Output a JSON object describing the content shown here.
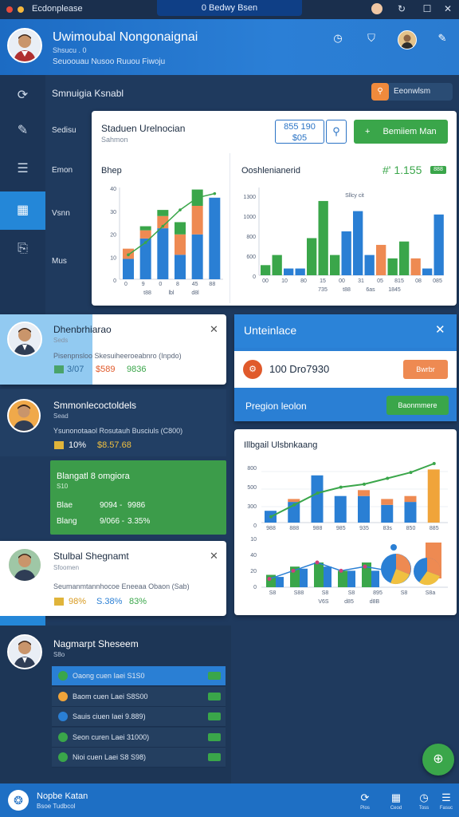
{
  "titlebar": {
    "app_name": "Ecdonplease",
    "tab_title": "0 Bedwy Bsen"
  },
  "header": {
    "title": "Uwimoubal Nongonaignai",
    "subtitle": "Shsucu . 0",
    "meta": "Seuoouau  Nusoo  Ruuou  Fiwoju",
    "icons": [
      "clock-icon",
      "shield-icon",
      "user-avatar",
      "wrench-icon"
    ]
  },
  "sidebar": {
    "items": [
      {
        "icon": "refresh-icon",
        "label": ""
      },
      {
        "icon": "edit-icon",
        "label": "Sedisu"
      },
      {
        "icon": "document-icon",
        "label": "Emon"
      },
      {
        "icon": "chart-icon",
        "label": "Vsnn"
      },
      {
        "icon": "clipboard-icon",
        "label": "Mus"
      }
    ]
  },
  "section": {
    "title": "Smnuigia Ksnabl",
    "pill_label": "Eeonwlsm"
  },
  "dashboard": {
    "title": "Staduen Urelnocian",
    "subtitle": "Sahmon",
    "search_value": "855  190",
    "search_value2": "$05",
    "action_label": "Bemiiem Man",
    "left_chart_label": "Bhep",
    "right_chart_label": "Ooshlenianerid",
    "big_number": "#' 1.155",
    "badge": "888",
    "left_axis_ticks": [
      "40",
      "30",
      "20",
      "10",
      "0"
    ],
    "left_x_ticks": [
      "0",
      "9",
      "0",
      "8",
      "45",
      "88"
    ],
    "left_x_caption": [
      "t88",
      "lbl",
      "d8l"
    ],
    "right_axis_ticks": [
      "1300",
      "1000",
      "800",
      "600",
      "0"
    ],
    "right_x_ticks": [
      "00",
      "10",
      "80",
      "15",
      "00",
      "31",
      "05",
      "815",
      "08",
      "085"
    ],
    "right_x_caption": [
      "735",
      "t88",
      "6as",
      "1845"
    ],
    "right_note": "Sllcy cit"
  },
  "chart_data": [
    {
      "type": "bar",
      "title": "Bhep",
      "categories": [
        "1",
        "2",
        "3",
        "4",
        "5",
        "6"
      ],
      "series": [
        {
          "values": [
            10,
            20,
            25,
            12,
            22,
            40
          ]
        },
        {
          "values": [
            5,
            4,
            6,
            10,
            14,
            0
          ]
        },
        {
          "values": [
            0,
            2,
            3,
            6,
            8,
            0
          ]
        }
      ],
      "line": [
        12,
        18,
        26,
        34,
        40,
        42
      ],
      "ylim": [
        0,
        45
      ]
    },
    {
      "type": "bar",
      "title": "Ooshlenianerid",
      "categories": [
        "1",
        "2",
        "3",
        "4",
        "5",
        "6",
        "7",
        "8",
        "9",
        "10",
        "11",
        "12",
        "13",
        "14",
        "15",
        "16"
      ],
      "values": [
        150,
        300,
        100,
        100,
        550,
        1100,
        300,
        650,
        950,
        300,
        450,
        250,
        500,
        250,
        100,
        900
      ],
      "colors": [
        "#3aa64a",
        "#3aa64a",
        "#2a7fd4",
        "#2a7fd4",
        "#3aa64a",
        "#3aa64a",
        "#3aa64a",
        "#2a7fd4",
        "#2a7fd4",
        "#2a7fd4",
        "#ee8a52",
        "#3aa64a",
        "#3aa64a",
        "#ee8a52",
        "#2a7fd4",
        "#2a7fd4"
      ],
      "ylim": [
        0,
        1300
      ]
    },
    {
      "type": "bar",
      "title": "Illbgail Ulsbnkaang",
      "categories": [
        "1",
        "2",
        "3",
        "4",
        "5",
        "6",
        "7",
        "8"
      ],
      "series": [
        {
          "name": "",
          "values": [
            20,
            35,
            80,
            45,
            45,
            30,
            35,
            90
          ]
        },
        {
          "name": "",
          "values": [
            0,
            5,
            0,
            0,
            10,
            10,
            10,
            0
          ]
        }
      ],
      "line": [
        10,
        30,
        50,
        60,
        65,
        75,
        85,
        100
      ],
      "ylim": [
        0,
        100
      ]
    },
    {
      "type": "bar",
      "categories": [
        "1",
        "2",
        "3",
        "4",
        "5",
        "6",
        "7"
      ],
      "series": [
        {
          "name": "",
          "values": [
            15,
            25,
            30,
            20,
            30,
            20,
            25
          ]
        },
        {
          "name": "",
          "values": [
            5,
            10,
            10,
            10,
            5,
            10,
            60
          ]
        }
      ],
      "ylim": [
        0,
        60
      ]
    }
  ],
  "cards": [
    {
      "name": "Dhenbrhiarao",
      "sub": "Seds",
      "desc": "Pisenpnsloo  Skesuiheeroeabnro (Inpdo)",
      "stat1": "3/07",
      "stat2": "$589",
      "stat3": "9836"
    },
    {
      "name": "Smmonlecoctoldels",
      "sub": "Sead",
      "desc": "Ysunonotaaol  Rosutauh Busciuls (C800)",
      "stat1": "10%",
      "stat2": "$8.57.68"
    },
    {
      "name": "Stulbal Shegnamt",
      "sub": "Sfoomen",
      "desc": "Seumanmtannhocoe Eneeaa Obaon (Sab)",
      "stat1": "98%",
      "stat2": "S.38%",
      "stat3": "83%"
    }
  ],
  "green_panel": {
    "title": "Blangatl 8 omgiora",
    "sub": "S10",
    "rows": [
      {
        "label": "Blae",
        "v1": "9094 -",
        "v2": "9986"
      },
      {
        "label": "Blang",
        "v1": "9/066 -",
        "v2": "3.35%"
      }
    ]
  },
  "info_panel": {
    "title": "Unteinlace",
    "number": "100 Dro7930",
    "button": "Bwrbr",
    "footer_text": "Pregion leolon",
    "footer_button": "Baonmmere"
  },
  "chart_card2": {
    "title": "Illbgail Ulsbnkaang",
    "y_ticks": [
      "800",
      "500",
      "300",
      "0"
    ],
    "x_ticks": [
      "988",
      "888",
      "988",
      "985",
      "935",
      "83s",
      "850",
      "885"
    ],
    "y2_ticks": [
      "10",
      "40",
      "20",
      "0"
    ],
    "x2_ticks": [
      "S8",
      "S88",
      "S8",
      "S8",
      "895",
      "S8",
      "S8a"
    ],
    "x2_caption": [
      "V6S",
      "d85",
      "d8B"
    ]
  },
  "list_section": {
    "name": "Nagmarpt Sheseem",
    "sub": "S8o",
    "items": [
      {
        "icon": "green",
        "text": "Oaong cuen Iaei  S1S0"
      },
      {
        "icon": "orange",
        "text": "Baom cuen Laei  S8S00"
      },
      {
        "icon": "blue",
        "text": "Sauis ciuen Iaei  9.889)"
      },
      {
        "icon": "green",
        "text": "Seon curen Laei  31000)"
      },
      {
        "icon": "green",
        "text": "Nioi cuen Laei  S8 S98)"
      }
    ]
  },
  "footer": {
    "title": "Nopbe Katan",
    "subtitle": "Bsoe Tudbcol",
    "icons": [
      {
        "icon": "sync-icon",
        "label": "Plos"
      },
      {
        "icon": "grid-icon",
        "label": "Ceod"
      },
      {
        "icon": "time-icon",
        "label": "Toss"
      },
      {
        "icon": "list-icon",
        "label": "Fasuc"
      }
    ]
  },
  "colors": {
    "primary": "#2a7fd4",
    "accent_green": "#3aa64a",
    "accent_orange": "#ee8a52",
    "bg": "#1f3a5e"
  }
}
